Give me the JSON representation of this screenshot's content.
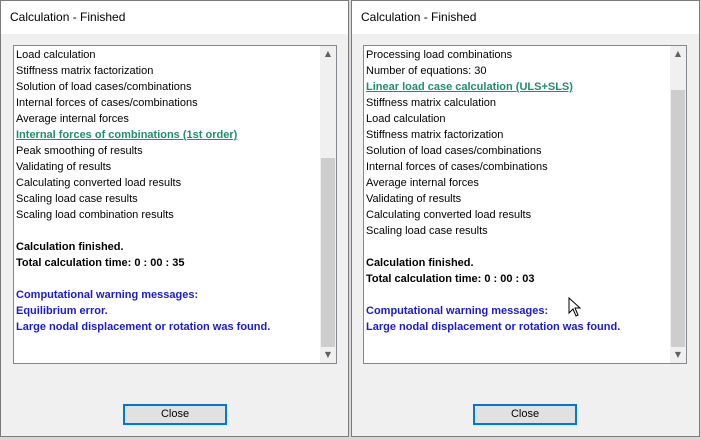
{
  "left_dialog": {
    "title": "Calculation - Finished",
    "log": [
      {
        "text": "Load calculation",
        "style": "normal"
      },
      {
        "text": "Stiffness matrix factorization",
        "style": "normal"
      },
      {
        "text": "Solution of load cases/combinations",
        "style": "normal"
      },
      {
        "text": "Internal forces of cases/combinations",
        "style": "normal"
      },
      {
        "text": "Average internal forces",
        "style": "normal"
      },
      {
        "text": "Internal forces of combinations (1st order)",
        "style": "link"
      },
      {
        "text": "Peak smoothing of results",
        "style": "normal"
      },
      {
        "text": "Validating of results",
        "style": "normal"
      },
      {
        "text": "Calculating converted load results",
        "style": "normal"
      },
      {
        "text": "Scaling load case results",
        "style": "normal"
      },
      {
        "text": "Scaling load combination results",
        "style": "normal"
      },
      {
        "text": "",
        "style": "blank"
      },
      {
        "text": "Calculation finished.",
        "style": "bold"
      },
      {
        "text": "Total calculation time:   0 : 00 : 35",
        "style": "bold"
      },
      {
        "text": "",
        "style": "blank"
      },
      {
        "text": "Computational warning messages:",
        "style": "warn"
      },
      {
        "text": "Equilibrium error.",
        "style": "warn"
      },
      {
        "text": "Large nodal displacement or rotation was found.",
        "style": "warn"
      }
    ],
    "scroll_position": 0.85,
    "close_label": "Close"
  },
  "right_dialog": {
    "title": "Calculation - Finished",
    "log": [
      {
        "text": "Processing load combinations",
        "style": "normal"
      },
      {
        "text": "Number of equations: 30",
        "style": "normal"
      },
      {
        "text": "Linear load case calculation (ULS+SLS)",
        "style": "link"
      },
      {
        "text": "Stiffness matrix calculation",
        "style": "normal"
      },
      {
        "text": "Load calculation",
        "style": "normal"
      },
      {
        "text": "Stiffness matrix factorization",
        "style": "normal"
      },
      {
        "text": "Solution of load cases/combinations",
        "style": "normal"
      },
      {
        "text": "Internal forces of cases/combinations",
        "style": "normal"
      },
      {
        "text": "Average internal forces",
        "style": "normal"
      },
      {
        "text": "Validating of results",
        "style": "normal"
      },
      {
        "text": "Calculating converted load results",
        "style": "normal"
      },
      {
        "text": "Scaling load case results",
        "style": "normal"
      },
      {
        "text": "",
        "style": "blank"
      },
      {
        "text": "Calculation finished.",
        "style": "bold"
      },
      {
        "text": "Total calculation time:   0 : 00 : 03",
        "style": "bold"
      },
      {
        "text": "",
        "style": "blank"
      },
      {
        "text": "Computational warning messages:",
        "style": "warn"
      },
      {
        "text": "Large nodal displacement or rotation was found.",
        "style": "warn"
      }
    ],
    "scroll_position": 0.8,
    "close_label": "Close"
  },
  "icons": {
    "scroll_up": "scroll-up-arrow-icon",
    "scroll_down": "scroll-down-arrow-icon",
    "cursor": "mouse-pointer-icon"
  },
  "colors": {
    "link": "#1e8f6e",
    "warning": "#1b1bcf",
    "button_border": "#0078d7"
  }
}
